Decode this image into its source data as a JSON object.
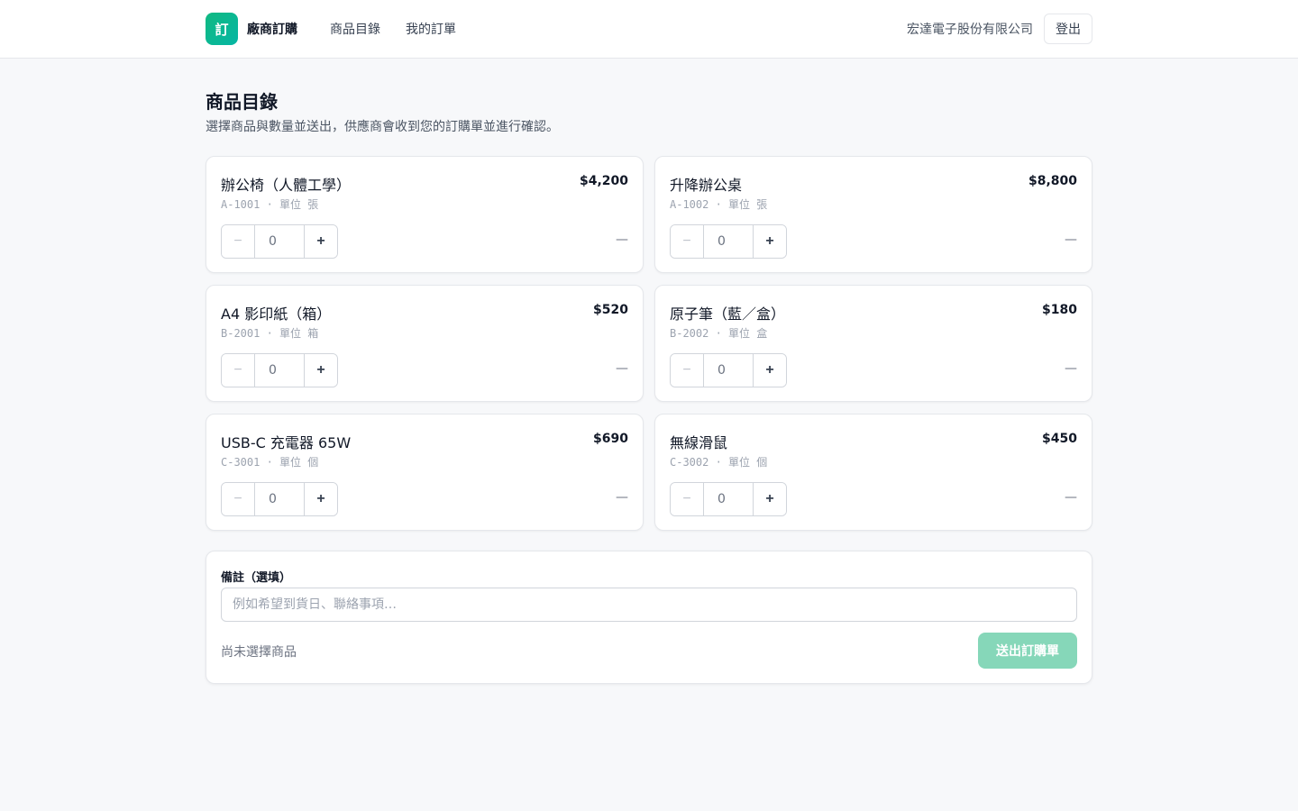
{
  "header": {
    "logo_text": "訂",
    "brand": "廠商訂購",
    "nav": [
      "商品目錄",
      "我的訂單"
    ],
    "company": "宏達電子股份有限公司",
    "logout_label": "登出"
  },
  "page": {
    "title": "商品目錄",
    "description": "選擇商品與數量並送出，供應商會收到您的訂購單並進行確認。"
  },
  "products": [
    {
      "name": "辦公椅（人體工學）",
      "price": "$4,200",
      "meta": "A-1001 · 單位 張",
      "qty": "0",
      "subtotal": "—"
    },
    {
      "name": "升降辦公桌",
      "price": "$8,800",
      "meta": "A-1002 · 單位 張",
      "qty": "0",
      "subtotal": "—"
    },
    {
      "name": "A4 影印紙（箱）",
      "price": "$520",
      "meta": "B-2001 · 單位 箱",
      "qty": "0",
      "subtotal": "—"
    },
    {
      "name": "原子筆（藍／盒）",
      "price": "$180",
      "meta": "B-2002 · 單位 盒",
      "qty": "0",
      "subtotal": "—"
    },
    {
      "name": "USB-C 充電器 65W",
      "price": "$690",
      "meta": "C-3001 · 單位 個",
      "qty": "0",
      "subtotal": "—"
    },
    {
      "name": "無線滑鼠",
      "price": "$450",
      "meta": "C-3002 · 單位 個",
      "qty": "0",
      "subtotal": "—"
    }
  ],
  "stepper": {
    "minus": "−",
    "plus": "+"
  },
  "notes": {
    "label": "備註（選填）",
    "placeholder": "例如希望到貨日、聯絡事項…",
    "value": ""
  },
  "footer": {
    "status": "尚未選擇商品",
    "submit_label": "送出訂購單"
  },
  "colors": {
    "accent": "#10b981",
    "submit_disabled": "#86d7b9"
  },
  "icons": {
    "minus": "minus-icon",
    "plus": "plus-icon"
  }
}
